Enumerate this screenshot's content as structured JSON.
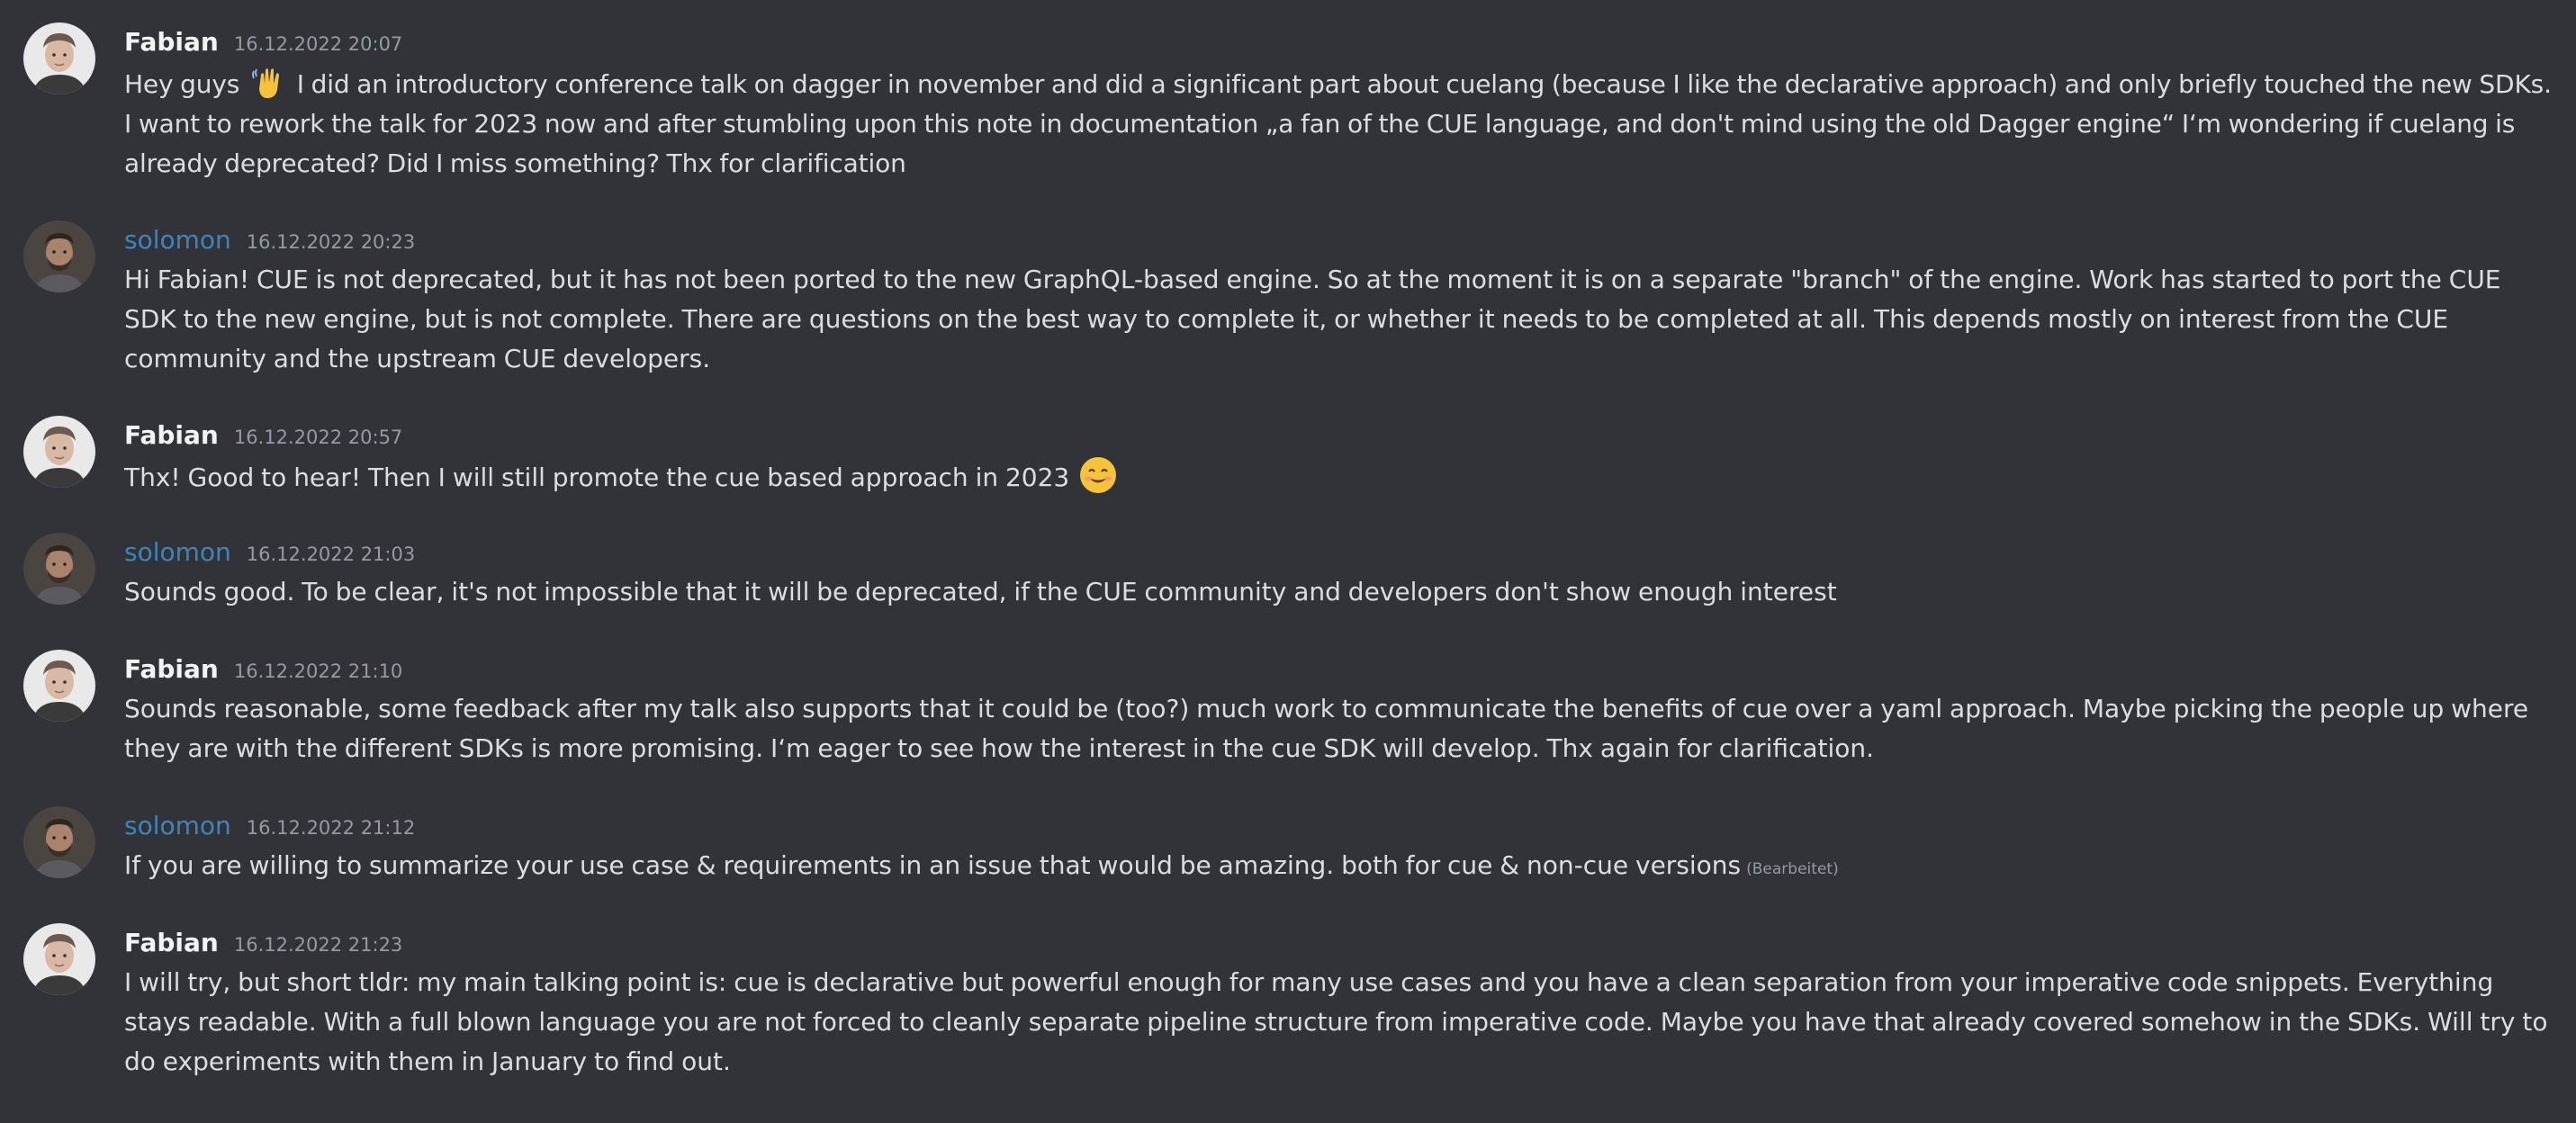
{
  "messages": [
    {
      "author": "Fabian",
      "author_color": "#f2f3f5",
      "timestamp": "16.12.2022 20:07",
      "text_before": "Hey guys",
      "emoji": "waving-hand-emoji",
      "text": "I did an introductory conference talk on dagger in november and did a significant part about cuelang (because I like the declarative approach) and only briefly touched the new SDKs. I want to rework the talk for 2023 now and after stumbling upon this note in documentation „a fan of the CUE language, and don't mind using the old Dagger engine“ I‘m wondering if cuelang is already deprecated? Did I miss something? Thx for clarification"
    },
    {
      "author": "solomon",
      "author_color": "#3e86b9",
      "timestamp": "16.12.2022 20:23",
      "text": "Hi Fabian! CUE is not deprecated, but it has not been ported to the new GraphQL-based engine. So at the moment it is on a separate \"branch\" of the engine. Work has started to port the CUE SDK to the new engine, but is not complete. There are questions on the best way to complete it, or whether it needs to be completed at all. This depends mostly on interest from the CUE community and the upstream CUE developers."
    },
    {
      "author": "Fabian",
      "author_color": "#f2f3f5",
      "timestamp": "16.12.2022 20:57",
      "text": "Thx! Good to hear! Then I will still promote the cue based approach in 2023",
      "emoji": "smiling-face-emoji"
    },
    {
      "author": "solomon",
      "author_color": "#3e86b9",
      "timestamp": "16.12.2022 21:03",
      "text": "Sounds good. To be clear, it's not impossible that it will be deprecated, if the CUE community and developers don't show enough interest"
    },
    {
      "author": "Fabian",
      "author_color": "#f2f3f5",
      "timestamp": "16.12.2022 21:10",
      "text": "Sounds reasonable, some feedback after my talk also supports that it could be (too?) much work to communicate the benefits of cue over a yaml approach. Maybe picking the people up where they are with the different SDKs is more promising. I‘m eager to see how the interest in the cue SDK will develop. Thx again for clarification."
    },
    {
      "author": "solomon",
      "author_color": "#3e86b9",
      "timestamp": "16.12.2022 21:12",
      "text": "If you are willing to summarize your use case & requirements in an issue that would be amazing. both for cue & non-cue versions",
      "edited": "(Bearbeitet)"
    },
    {
      "author": "Fabian",
      "author_color": "#f2f3f5",
      "timestamp": "16.12.2022 21:23",
      "text": "I will try, but short tldr: my main talking point is: cue is declarative but powerful enough for many use cases and you have a clean separation from your imperative code snippets. Everything stays readable. With a full blown language you are not forced to cleanly separate pipeline structure from imperative code. Maybe you have that already covered somehow in the SDKs. Will try to do experiments with them in January to find out."
    }
  ],
  "colors": {
    "background": "#313338",
    "text": "#dbdee1",
    "timestamp": "#949ba4",
    "solomon_name": "#3e86b9"
  }
}
